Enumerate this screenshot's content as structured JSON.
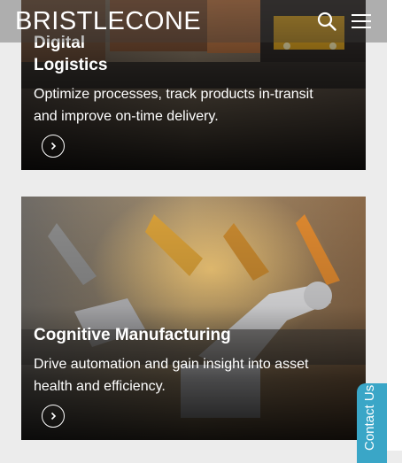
{
  "header": {
    "logo_text": "BRISTLECONE",
    "search_icon": "search-icon",
    "menu_icon": "hamburger-menu-icon"
  },
  "cards": [
    {
      "title_line1": "Digital",
      "title_line2": "Logistics",
      "description_line1": "Optimize processes, track products in-transit",
      "description_line2": "and improve on-time delivery.",
      "button_icon": "chevron-right-icon"
    },
    {
      "title": "Cognitive Manufacturing",
      "description_line1": "Drive automation and gain insight into asset",
      "description_line2": "health and efficiency.",
      "button_icon": "chevron-right-icon"
    }
  ],
  "contact_tab": {
    "label": "Contact Us"
  },
  "colors": {
    "contact_tab": "#3aa6c7",
    "page_background": "#ececec"
  }
}
